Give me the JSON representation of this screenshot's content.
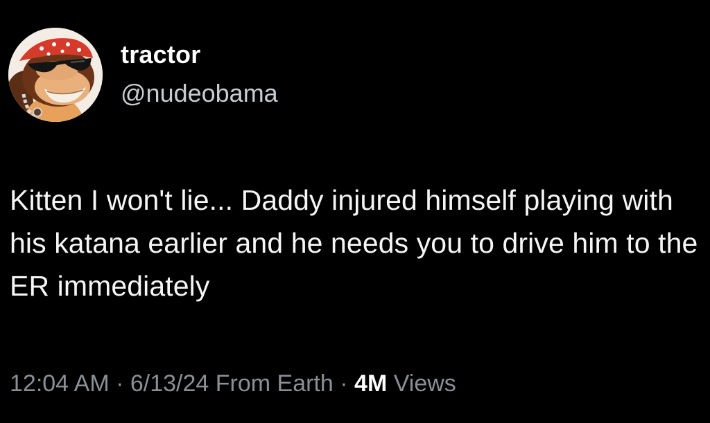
{
  "author": {
    "display_name": "tractor",
    "handle": "@nudeobama",
    "avatar": "donkey-kong-with-sunglasses-and-bandana-avatar"
  },
  "tweet": {
    "text": "Kitten I won't lie... Daddy injured himself playing with his katana earlier and he needs you to drive him to the ER immediately"
  },
  "meta": {
    "time": "12:04 AM",
    "separator": " · ",
    "date": "6/13/24",
    "source": " From Earth",
    "views_count": "4M",
    "views_label": " Views"
  },
  "colors": {
    "background": "#000000",
    "primary_text": "#ffffff",
    "secondary_text": "#8b9095"
  }
}
